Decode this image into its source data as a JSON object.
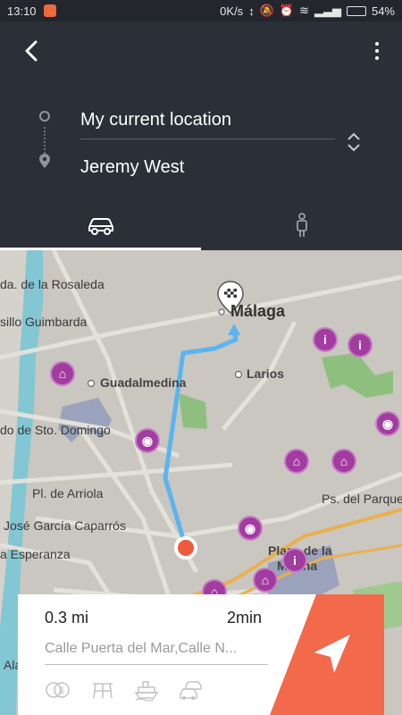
{
  "status_bar": {
    "time": "13:10",
    "network_speed": "0K/s",
    "battery_percent": "54%",
    "battery_level": 0.54
  },
  "route": {
    "origin": "My current location",
    "destination": "Jeremy West"
  },
  "modes": [
    {
      "name": "car",
      "active": true
    },
    {
      "name": "walk",
      "active": false
    }
  ],
  "map": {
    "labels": [
      "da. de la Rosaleda",
      "sillo Guimbarda",
      "Guadalmedina",
      "Larios",
      "Málaga",
      "do de Sto. Domingo",
      "Pl. de Arriola",
      "José García Caparrós",
      "a Esperanza",
      "Ps. del Parque",
      "Plaza de la",
      "Marina",
      "Ala"
    ]
  },
  "summary": {
    "distance": "0.3 mi",
    "duration": "2min",
    "via": "Calle Puerta del Mar,Calle N..."
  },
  "colors": {
    "header_bg": "#2b3038",
    "route_line": "#5ab4f0",
    "start_marker": "#f05a3c",
    "go_button": "#f26a4b",
    "poi": "#a23ca0"
  }
}
